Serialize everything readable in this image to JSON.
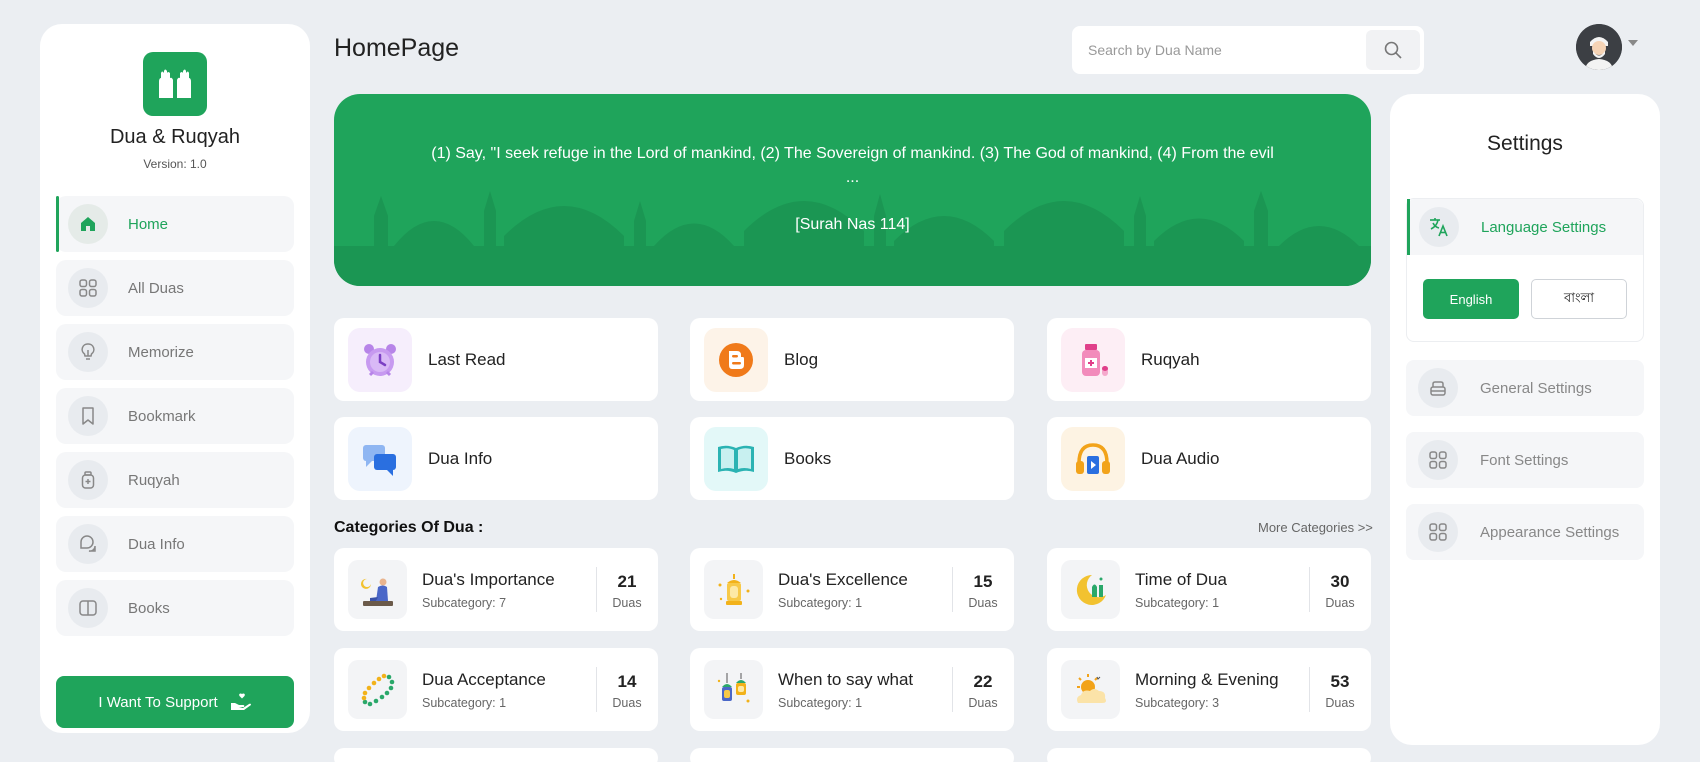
{
  "sidebar": {
    "app_name": "Dua & Ruqyah",
    "version": "Version: 1.0",
    "items": [
      {
        "label": "Home",
        "icon": "home-icon",
        "active": true
      },
      {
        "label": "All Duas",
        "icon": "grid-icon"
      },
      {
        "label": "Memorize",
        "icon": "bulb-icon"
      },
      {
        "label": "Bookmark",
        "icon": "bookmark-icon"
      },
      {
        "label": "Ruqyah",
        "icon": "bottle-icon"
      },
      {
        "label": "Dua Info",
        "icon": "chat-icon"
      },
      {
        "label": "Books",
        "icon": "book-icon"
      }
    ],
    "support_label": "I Want To Support"
  },
  "header": {
    "title": "HomePage",
    "search_placeholder": "Search by Dua Name"
  },
  "banner": {
    "quote": "(1) Say, \"I seek refuge in the Lord of mankind, (2) The Sovereign of mankind. (3) The God of mankind, (4) From the evil ...",
    "reference": "[Surah Nas 114]"
  },
  "quick_links": [
    {
      "label": "Last Read",
      "icon": "alarm-clock-icon"
    },
    {
      "label": "Blog",
      "icon": "blogger-icon"
    },
    {
      "label": "Ruqyah",
      "icon": "medicine-bottle-icon"
    },
    {
      "label": "Dua Info",
      "icon": "chat-bubbles-icon"
    },
    {
      "label": "Books",
      "icon": "open-book-icon"
    },
    {
      "label": "Dua Audio",
      "icon": "headphones-icon"
    }
  ],
  "categories": {
    "heading": "Categories Of Dua :",
    "more_label": "More Categories >>",
    "items": [
      {
        "title": "Dua's Importance",
        "sub": "Subcategory: 7",
        "count": "21",
        "unit": "Duas"
      },
      {
        "title": "Dua's Excellence",
        "sub": "Subcategory: 1",
        "count": "15",
        "unit": "Duas"
      },
      {
        "title": "Time of Dua",
        "sub": "Subcategory: 1",
        "count": "30",
        "unit": "Duas"
      },
      {
        "title": "Dua Acceptance",
        "sub": "Subcategory: 1",
        "count": "14",
        "unit": "Duas"
      },
      {
        "title": "When to say what",
        "sub": "Subcategory: 1",
        "count": "22",
        "unit": "Duas"
      },
      {
        "title": "Morning & Evening",
        "sub": "Subcategory: 3",
        "count": "53",
        "unit": "Duas"
      }
    ]
  },
  "settings": {
    "title": "Settings",
    "language_label": "Language Settings",
    "lang_english": "English",
    "lang_bangla": "বাংলা",
    "general_label": "General Settings",
    "font_label": "Font Settings",
    "appearance_label": "Appearance Settings"
  },
  "colors": {
    "accent": "#1fa45b",
    "background": "#ebeef2"
  }
}
